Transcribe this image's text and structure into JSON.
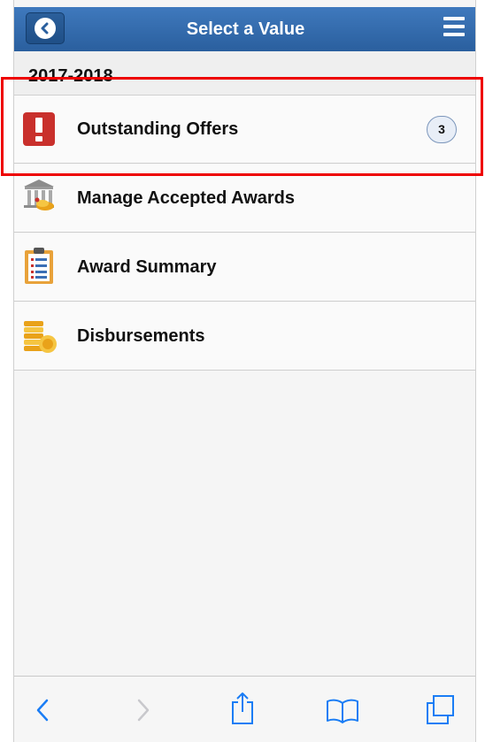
{
  "header": {
    "title": "Select a Value",
    "back_icon": "chevron-left-circle-icon",
    "menu_icon": "hamburger-menu-icon"
  },
  "section": {
    "title": "2017-2018"
  },
  "items": [
    {
      "label": "Outstanding Offers",
      "icon": "exclamation-icon",
      "count": "3"
    },
    {
      "label": "Manage Accepted Awards",
      "icon": "bank-coins-icon"
    },
    {
      "label": "Award Summary",
      "icon": "clipboard-list-icon"
    },
    {
      "label": "Disbursements",
      "icon": "coins-stack-icon"
    }
  ],
  "toolbar": {
    "icons": [
      "back-chevron-icon",
      "forward-chevron-icon",
      "share-icon",
      "bookmarks-icon",
      "tabs-icon"
    ]
  },
  "colors": {
    "header_blue": "#3f79bd",
    "alert_red": "#c9302c",
    "highlight_red": "#ee0000",
    "ios_blue": "#1a7df5",
    "disabled_gray": "#c8c8cc"
  }
}
